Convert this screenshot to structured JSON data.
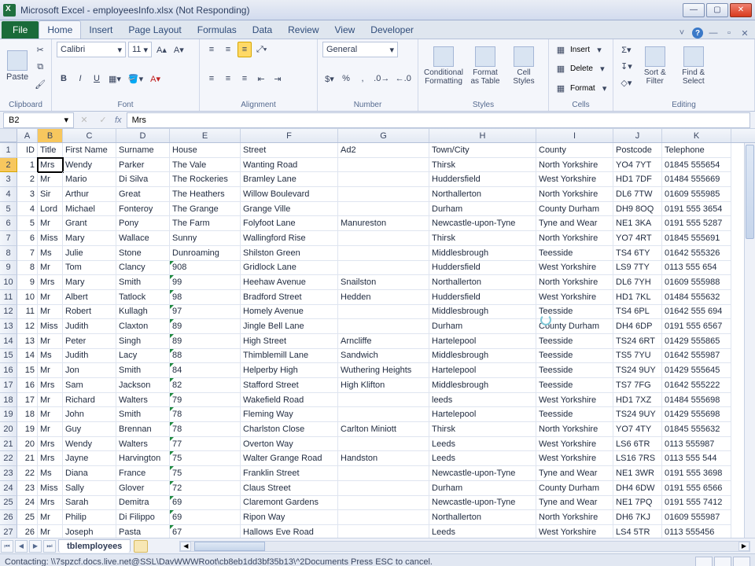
{
  "window": {
    "title": "Microsoft Excel - employeesInfo.xlsx (Not Responding)"
  },
  "tabs": {
    "file": "File",
    "list": [
      "Home",
      "Insert",
      "Page Layout",
      "Formulas",
      "Data",
      "Review",
      "View",
      "Developer"
    ],
    "active": "Home"
  },
  "ribbon": {
    "clipboard": {
      "label": "Clipboard",
      "paste": "Paste"
    },
    "font": {
      "label": "Font",
      "name": "Calibri",
      "size": "11"
    },
    "alignment": {
      "label": "Alignment"
    },
    "number": {
      "label": "Number",
      "format": "General"
    },
    "styles": {
      "label": "Styles",
      "cond": "Conditional Formatting",
      "tbl": "Format as Table",
      "cell": "Cell Styles"
    },
    "cells": {
      "label": "Cells",
      "insert": "Insert",
      "delete": "Delete",
      "format": "Format"
    },
    "editing": {
      "label": "Editing",
      "sort": "Sort & Filter",
      "find": "Find & Select"
    }
  },
  "formula": {
    "namebox": "B2",
    "fx": "fx",
    "value": "Mrs"
  },
  "columns": [
    {
      "letter": "A",
      "w": 26
    },
    {
      "letter": "B",
      "w": 32
    },
    {
      "letter": "C",
      "w": 68
    },
    {
      "letter": "D",
      "w": 68
    },
    {
      "letter": "E",
      "w": 90
    },
    {
      "letter": "F",
      "w": 124
    },
    {
      "letter": "G",
      "w": 116
    },
    {
      "letter": "H",
      "w": 136
    },
    {
      "letter": "I",
      "w": 98
    },
    {
      "letter": "J",
      "w": 62
    },
    {
      "letter": "K",
      "w": 88
    }
  ],
  "headers": [
    "ID",
    "Title",
    "First Name",
    "Surname",
    "House",
    "Street",
    "Ad2",
    "Town/City",
    "County",
    "Postcode",
    "Telephone"
  ],
  "rows": [
    [
      "1",
      "Mrs",
      "Wendy",
      "Parker",
      "The Vale",
      "Wanting Road",
      "",
      "Thirsk",
      "North Yorkshire",
      "YO4 7YT",
      "01845 555654"
    ],
    [
      "2",
      "Mr",
      "Mario",
      "Di Silva",
      "The Rockeries",
      "Bramley Lane",
      "",
      "Huddersfield",
      "West Yorkshire",
      "HD1 7DF",
      "01484 555669"
    ],
    [
      "3",
      "Sir",
      "Arthur",
      "Great",
      "The Heathers",
      "Willow Boulevard",
      "",
      "Northallerton",
      "North Yorkshire",
      "DL6 7TW",
      "01609 555985"
    ],
    [
      "4",
      "Lord",
      "Michael",
      "Fonteroy",
      "The Grange",
      "Grange Ville",
      "",
      "Durham",
      "County Durham",
      "DH9 8OQ",
      "0191 555 3654"
    ],
    [
      "5",
      "Mr",
      "Grant",
      "Pony",
      "The Farm",
      "Folyfoot Lane",
      "Manureston",
      "Newcastle-upon-Tyne",
      "Tyne and Wear",
      "NE1 3KA",
      "0191 555 5287"
    ],
    [
      "6",
      "Miss",
      "Mary",
      "Wallace",
      "Sunny",
      "Wallingford Rise",
      "",
      "Thirsk",
      "North Yorkshire",
      "YO7 4RT",
      "01845 555691"
    ],
    [
      "7",
      "Ms",
      "Julie",
      "Stone",
      "Dunroaming",
      "Shilston Green",
      "",
      "Middlesbrough",
      "Teesside",
      "TS4 6TY",
      "01642 555326"
    ],
    [
      "8",
      "Mr",
      "Tom",
      "Clancy",
      "908",
      "Gridlock Lane",
      "",
      "Huddersfield",
      "West Yorkshire",
      "LS9 7TY",
      "0113 555 654"
    ],
    [
      "9",
      "Mrs",
      "Mary",
      "Smith",
      "99",
      "Heehaw Avenue",
      "Snailston",
      "Northallerton",
      "North Yorkshire",
      "DL6 7YH",
      "01609 555988"
    ],
    [
      "10",
      "Mr",
      "Albert",
      "Tatlock",
      "98",
      "Bradford Street",
      "Hedden",
      "Huddersfield",
      "West Yorkshire",
      "HD1 7KL",
      "01484 555632"
    ],
    [
      "11",
      "Mr",
      "Robert",
      "Kullagh",
      "97",
      "Homely Avenue",
      "",
      "Middlesbrough",
      "Teesside",
      "TS4 6PL",
      "01642 555 694"
    ],
    [
      "12",
      "Miss",
      "Judith",
      "Claxton",
      "89",
      "Jingle Bell Lane",
      "",
      "Durham",
      "County Durham",
      "DH4 6DP",
      "0191 555 6567"
    ],
    [
      "13",
      "Mr",
      "Peter",
      "Singh",
      "89",
      "High Street",
      "Arncliffe",
      "Hartelepool",
      "Teesside",
      "TS24 6RT",
      "01429 555865"
    ],
    [
      "14",
      "Ms",
      "Judith",
      "Lacy",
      "88",
      "Thimblemill Lane",
      "Sandwich",
      "Middlesbrough",
      "Teesside",
      "TS5 7YU",
      "01642 555987"
    ],
    [
      "15",
      "Mr",
      "Jon",
      "Smith",
      "84",
      "Helperby High",
      "Wuthering Heights",
      "Hartelepool",
      "Teesside",
      "TS24 9UY",
      "01429 555645"
    ],
    [
      "16",
      "Mrs",
      "Sam",
      "Jackson",
      "82",
      "Stafford Street",
      "High Klifton",
      "Middlesbrough",
      "Teesside",
      "TS7 7FG",
      "01642 555222"
    ],
    [
      "17",
      "Mr",
      "Richard",
      "Walters",
      "79",
      "Wakefield Road",
      "",
      "leeds",
      "West Yorkshire",
      "HD1 7XZ",
      "01484 555698"
    ],
    [
      "18",
      "Mr",
      "John",
      "Smith",
      "78",
      "Fleming Way",
      "",
      "Hartelepool",
      "Teesside",
      "TS24 9UY",
      "01429 555698"
    ],
    [
      "19",
      "Mr",
      "Guy",
      "Brennan",
      "78",
      "Charlston Close",
      "Carlton Miniott",
      "Thirsk",
      "North Yorkshire",
      "YO7 4TY",
      "01845 555632"
    ],
    [
      "20",
      "Mrs",
      "Wendy",
      "Walters",
      "77",
      "Overton Way",
      "",
      "Leeds",
      "West Yorkshire",
      "LS6 6TR",
      "0113 555987"
    ],
    [
      "21",
      "Mrs",
      "Jayne",
      "Harvington",
      "75",
      "Walter Grange Road",
      "Handston",
      "Leeds",
      "West Yorkshire",
      "LS16 7RS",
      "0113 555 544"
    ],
    [
      "22",
      "Ms",
      "Diana",
      "France",
      "75",
      "Franklin Street",
      "",
      "Newcastle-upon-Tyne",
      "Tyne and Wear",
      "NE1 3WR",
      "0191 555 3698"
    ],
    [
      "23",
      "Miss",
      "Sally",
      "Glover",
      "72",
      "Claus Street",
      "",
      "Durham",
      "County Durham",
      "DH4 6DW",
      "0191 555 6566"
    ],
    [
      "24",
      "Mrs",
      "Sarah",
      "Demitra",
      "69",
      "Claremont Gardens",
      "",
      "Newcastle-upon-Tyne",
      "Tyne and Wear",
      "NE1 7PQ",
      "0191 555 7412"
    ],
    [
      "25",
      "Mr",
      "Philip",
      "Di Filippo",
      "69",
      "Ripon Way",
      "",
      "Northallerton",
      "North Yorkshire",
      "DH6 7KJ",
      "01609 555987"
    ],
    [
      "26",
      "Mr",
      "Joseph",
      "Pasta",
      "67",
      "Hallows Eve Road",
      "",
      "Leeds",
      "West Yorkshire",
      "LS4 5TR",
      "0113 555456"
    ]
  ],
  "sheet": {
    "name": "tblemployees"
  },
  "status": {
    "text": "Contacting: \\\\7spzcf.docs.live.net@SSL\\DavWWWRoot\\cb8eb1dd3bf35b13\\^2Documents Press ESC to cancel."
  }
}
